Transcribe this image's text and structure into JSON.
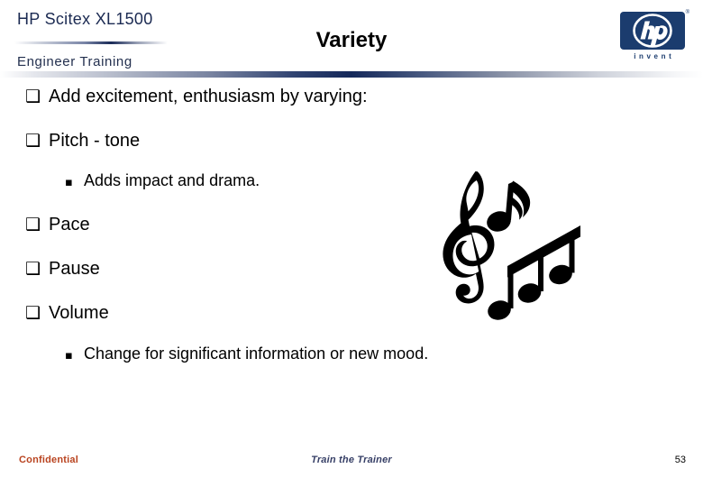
{
  "header": {
    "brand_title": "HP Scitex XL1500",
    "brand_subtitle": "Engineer Training",
    "slide_title": "Variety",
    "logo": {
      "wordmark": "hp",
      "tagline": "invent",
      "trademark": "®",
      "badge_color": "#1b3c6e"
    },
    "rule_color_dark": "#142a5a",
    "rule_color_light": "#ffffff"
  },
  "bullets": [
    {
      "level": 1,
      "marker": "❑",
      "marker_name": "hollow-square-bullet",
      "text": "Add excitement, enthusiasm by varying:"
    },
    {
      "level": 1,
      "marker": "❑",
      "marker_name": "hollow-square-bullet",
      "text": "Pitch - tone"
    },
    {
      "level": 2,
      "marker": "▪",
      "marker_name": "small-filled-square-bullet",
      "text": "Adds impact and drama."
    },
    {
      "level": 1,
      "marker": "❑",
      "marker_name": "hollow-square-bullet",
      "text": "Pace"
    },
    {
      "level": 1,
      "marker": "❑",
      "marker_name": "hollow-square-bullet",
      "text": "Pause"
    },
    {
      "level": 1,
      "marker": "❑",
      "marker_name": "hollow-square-bullet",
      "text": "Volume"
    },
    {
      "level": 2,
      "marker": "▪",
      "marker_name": "small-filled-square-bullet",
      "text": "Change for significant information or new mood."
    }
  ],
  "clipart": {
    "name": "music-notes-clipart",
    "elements": [
      "treble-clef",
      "eighth-note",
      "beamed-eighth-notes-triple"
    ],
    "color": "#000000"
  },
  "footer": {
    "confidential": "Confidential",
    "confidential_color": "#b9431f",
    "center_label": "Train the Trainer",
    "center_color": "#363f66",
    "page_number": "53"
  }
}
